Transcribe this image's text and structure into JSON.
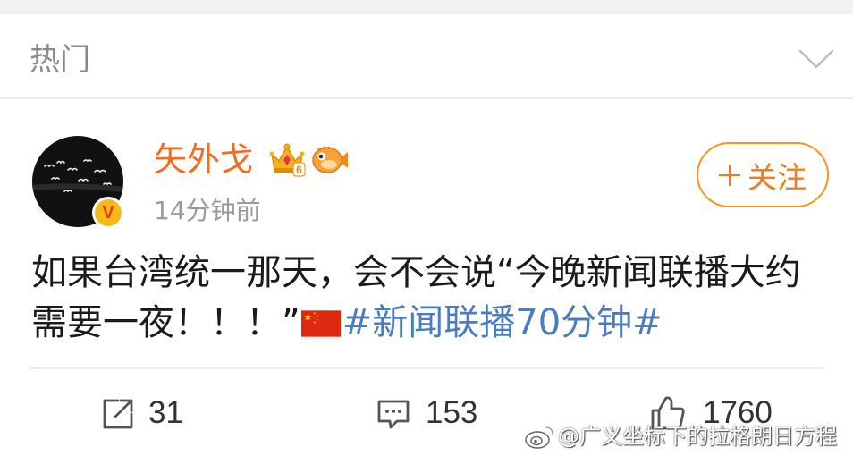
{
  "header": {
    "title": "热门",
    "icon": "chevron-down-icon"
  },
  "post": {
    "author": {
      "name": "矢外戈",
      "verified_badge": "V",
      "badges": [
        {
          "icon": "crown-icon",
          "level": "6"
        },
        {
          "icon": "fish-icon"
        }
      ],
      "time": "14分钟前"
    },
    "follow_button": {
      "icon": "plus-icon",
      "label": "关注"
    },
    "content": {
      "lines": [
        "如果台湾统一那天，会不会说“今晚新闻联播大约",
        "需要一夜！！！”"
      ],
      "emoji": "china-flag-icon",
      "hashtag": "#新闻联播70分钟#"
    }
  },
  "actions": {
    "repost": {
      "icon": "share-icon",
      "count": "31"
    },
    "comment": {
      "icon": "comment-icon",
      "count": "153"
    },
    "like": {
      "icon": "like-icon",
      "count": "1760"
    }
  },
  "watermark": {
    "icon": "weibo-logo-icon",
    "text": "@广义坐标下的拉格朗日方程"
  },
  "colors": {
    "accent": "#f36c21",
    "hashtag": "#4a7cc0",
    "muted": "#9b9b9b",
    "text": "#1a1a1a"
  }
}
